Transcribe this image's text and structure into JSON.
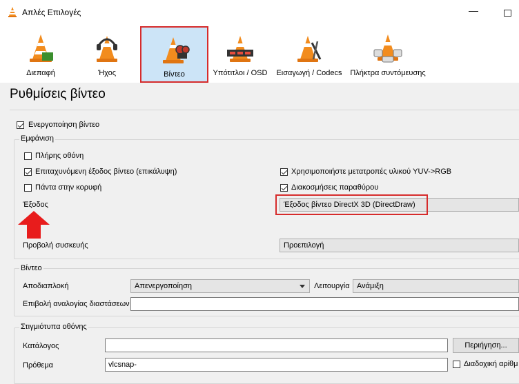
{
  "window": {
    "title": "Απλές Επιλογές",
    "minimize_glyph": "—"
  },
  "tabs": [
    {
      "label": "Διεπαφή",
      "icon": "interface-cone-icon"
    },
    {
      "label": "Ήχος",
      "icon": "audio-headphones-cone-icon"
    },
    {
      "label": "Βίντεο",
      "icon": "video-cone-icon",
      "selected": true
    },
    {
      "label": "Υπότιτλοι / OSD",
      "icon": "subtitles-cone-icon"
    },
    {
      "label": "Εισαγωγή / Codecs",
      "icon": "codecs-cone-icon"
    },
    {
      "label": "Πλήκτρα συντόμευσης",
      "icon": "hotkeys-cone-icon"
    }
  ],
  "page_title": "Ρυθμίσεις βίντεο",
  "enable_video": {
    "label": "Ενεργοποίηση βίντεο",
    "checked": true
  },
  "display": {
    "label": "Εμφάνιση",
    "fullscreen": {
      "label": "Πλήρης οθόνη",
      "checked": false
    },
    "overlay": {
      "label": "Επιταχυνόμενη έξοδος βίντεο (επικάλυψη)",
      "checked": true
    },
    "always_on_top": {
      "label": "Πάντα στην κορυφή",
      "checked": false
    },
    "yuv_rgb": {
      "label": "Χρησιμοποιήστε μετατροπές υλικού YUV->RGB",
      "checked": true
    },
    "window_decorations": {
      "label": "Διακοσμήσεις παραθύρου",
      "checked": true
    },
    "output_label": "Έξοδος",
    "output_value": "Έξοδος βίντεο DirectX 3D (DirectDraw)",
    "device_label": "Προβολή συσκευής",
    "device_value": "Προεπιλογή"
  },
  "video": {
    "label": "Βίντεο",
    "deinterlace_label": "Αποδιαπλοκή",
    "deinterlace_value": "Απενεργοποίηση",
    "mode_label": "Λειτουργία",
    "mode_value": "Ανάμιξη",
    "aspect_label": "Επιβολή αναλογίας διαστάσεων",
    "aspect_value": ""
  },
  "snapshots": {
    "label": "Στιγμιότυπα οθόνης",
    "directory_label": "Κατάλογος",
    "directory_value": "",
    "browse_label": "Περιήγηση...",
    "prefix_label": "Πρόθεμα",
    "prefix_value": "vlcsnap-",
    "sequential_label": "Διαδοχική αρίθμ",
    "sequential_checked": false
  },
  "colors": {
    "highlight": "#d62b2b",
    "selected_tab": "#cce4f7",
    "cone_orange": "#f28c1e"
  }
}
